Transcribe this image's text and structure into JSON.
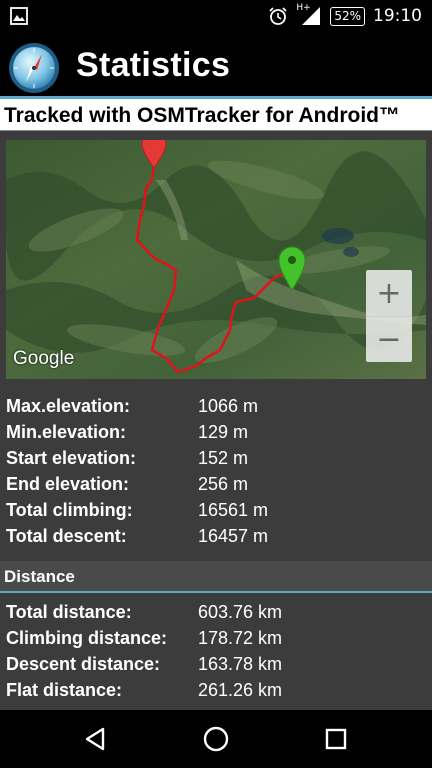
{
  "status_bar": {
    "time": "19:10",
    "battery": "52%",
    "network": "H+",
    "icons": [
      "image-icon",
      "alarm-icon",
      "signal-icon",
      "battery-icon"
    ]
  },
  "action_bar": {
    "title": "Statistics",
    "icon": "compass-app-icon"
  },
  "subtitle": "Tracked with OSMTracker for Android™",
  "map": {
    "attribution": "Google",
    "zoom_in_label": "+",
    "zoom_out_label": "−",
    "start_marker_color": "#e53935",
    "end_marker_color": "#43c22b",
    "track_color": "#e0131b"
  },
  "elevation": [
    {
      "label": "Max.elevation:",
      "value": "1066 m"
    },
    {
      "label": "Min.elevation:",
      "value": "129 m"
    },
    {
      "label": "Start elevation:",
      "value": "152 m"
    },
    {
      "label": "End elevation:",
      "value": "256 m"
    },
    {
      "label": "Total climbing:",
      "value": "16561 m"
    },
    {
      "label": "Total descent:",
      "value": "16457 m"
    }
  ],
  "distance_section": {
    "title": "Distance",
    "rows": [
      {
        "label": "Total distance:",
        "value": "603.76 km"
      },
      {
        "label": "Climbing distance:",
        "value": "178.72 km"
      },
      {
        "label": "Descent distance:",
        "value": "163.78 km"
      },
      {
        "label": "Flat distance:",
        "value": "261.26 km"
      }
    ]
  },
  "nav_bar": {
    "buttons": [
      "back-icon",
      "home-icon",
      "recents-icon"
    ]
  }
}
